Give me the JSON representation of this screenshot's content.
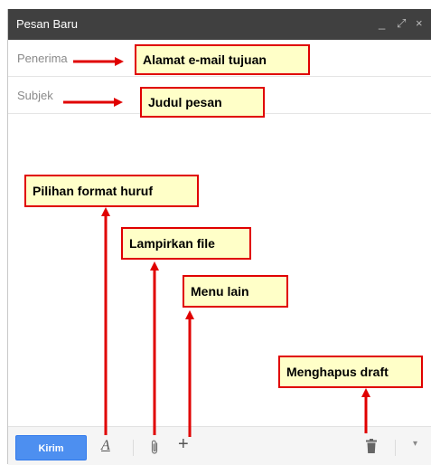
{
  "window": {
    "title": "Pesan Baru",
    "controls": {
      "minimize": "_",
      "popout": "⤢",
      "close": "×"
    }
  },
  "fields": {
    "to_placeholder": "Penerima",
    "subject_placeholder": "Subjek"
  },
  "toolbar": {
    "send_label": "Kirim",
    "format_icon": "A",
    "attach_icon": "paperclip",
    "more_icon": "+",
    "delete_icon": "trash",
    "options_icon": "▾"
  },
  "annotations": {
    "recipient": "Alamat e-mail tujuan",
    "subject": "Judul pesan",
    "format": "Pilihan format huruf",
    "attach": "Lampirkan file",
    "more": "Menu lain",
    "delete": "Menghapus draft"
  },
  "colors": {
    "titlebar": "#404040",
    "send_button": "#4d8ff0",
    "callout_bg": "#ffffc8",
    "callout_border": "#e00000",
    "arrow": "#e00000"
  }
}
